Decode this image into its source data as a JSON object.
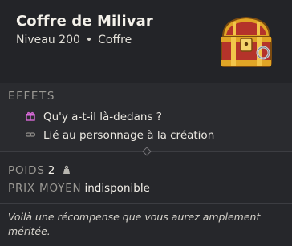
{
  "item": {
    "name": "Coffre de Milivar",
    "level": "Niveau 200",
    "separator": "•",
    "category": "Coffre",
    "icon": "treasure-chest-icon"
  },
  "effects": {
    "title": "EFFETS",
    "items": [
      {
        "icon": "gift-icon",
        "text": "Qu'y a-t-il là-dedans ?"
      },
      {
        "icon": "link-icon",
        "text": "Lié au personnage à la création"
      }
    ]
  },
  "stats": {
    "weight_label": "POIDS",
    "weight_value": "2",
    "weight_icon": "weight-icon",
    "price_label": "PRIX MOYEN",
    "price_value": "indisponible"
  },
  "description": "Voilà une récompense que vous aurez amplement méritée.",
  "colors": {
    "background": "#26272b",
    "gift": "#d86ad8",
    "chest_gold": "#e0a526",
    "chest_red": "#b4332a"
  }
}
